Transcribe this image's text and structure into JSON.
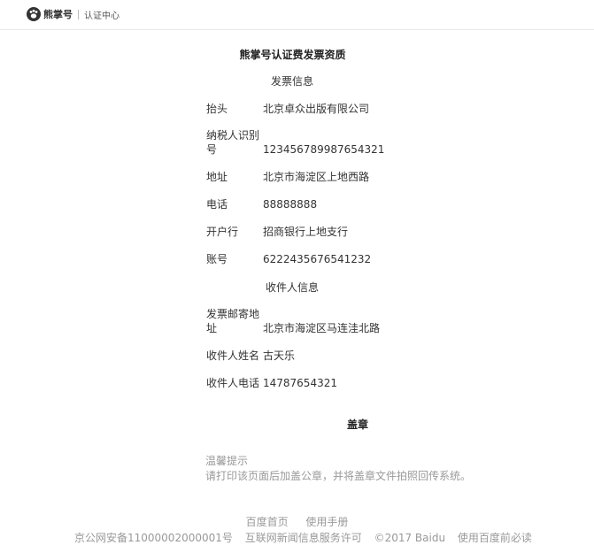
{
  "header": {
    "logo_text": "熊掌号",
    "subtitle": "认证中心"
  },
  "page": {
    "title": "熊掌号认证费发票资质"
  },
  "invoice_info": {
    "heading": "发票信息",
    "rows": [
      {
        "label": "抬头",
        "value": "北京卓众出版有限公司"
      },
      {
        "label_line1": "纳税人识别",
        "label_line2": "号",
        "value": "123456789987654321"
      },
      {
        "label": "地址",
        "value": "北京市海淀区上地西路"
      },
      {
        "label": "电话",
        "value": "88888888"
      },
      {
        "label": "开户行",
        "value": "招商银行上地支行"
      },
      {
        "label": "账号",
        "value": "6222435676541232"
      }
    ]
  },
  "recipient_info": {
    "heading": "收件人信息",
    "rows": [
      {
        "label_line1": "发票邮寄地",
        "label_line2": "址",
        "value": "北京市海淀区马连洼北路"
      },
      {
        "label": "收件人姓名",
        "value": "古天乐"
      },
      {
        "label": "收件人电话",
        "value": "14787654321"
      }
    ]
  },
  "stamp": {
    "label": "盖章"
  },
  "tip": {
    "title": "温馨提示",
    "text": "请打印该页面后加盖公章，并将盖章文件拍照回传系统。"
  },
  "footer": {
    "links": [
      "百度首页",
      "使用手册"
    ],
    "legal": [
      "京公网安备11000002000001号",
      "互联网新闻信息服务许可",
      "©2017 Baidu",
      "使用百度前必读"
    ]
  }
}
